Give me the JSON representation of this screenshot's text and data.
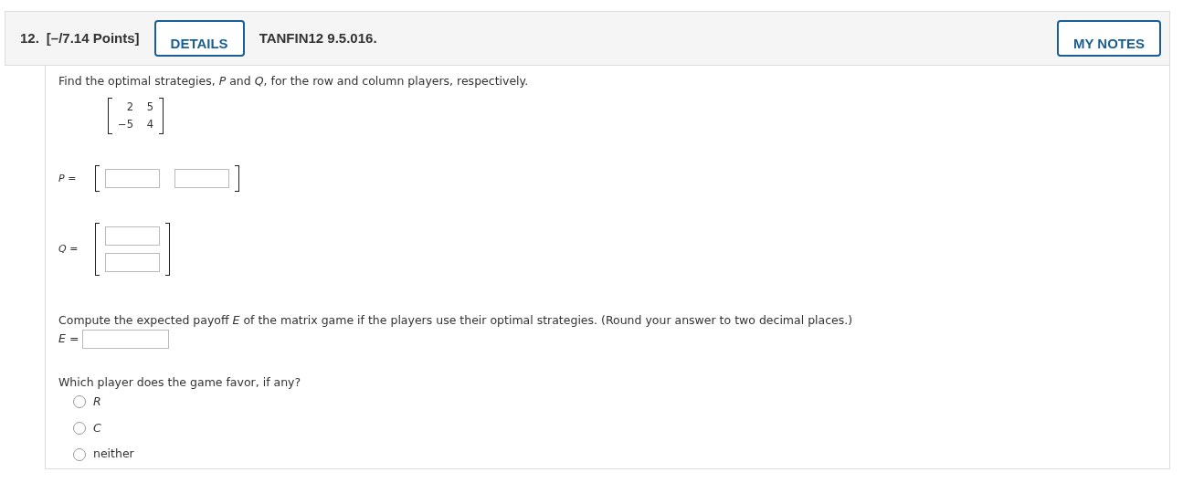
{
  "header": {
    "number": "12.",
    "points": "[–/7.14 Points]",
    "details_button": "DETAILS",
    "code": "TANFIN12 9.5.016.",
    "notes_button": "MY NOTES"
  },
  "question": {
    "prompt": "Find the optimal strategies, *P* and *Q*, for the row and column players, respectively.",
    "matrix": [
      [
        "2",
        "5"
      ],
      [
        "−5",
        "4"
      ]
    ],
    "p_label": "*P* =",
    "q_label": "*Q* =",
    "payoff_prompt": "Compute the expected payoff *E* of the matrix game if the players use their optimal strategies. (Round your answer to two decimal places.)",
    "e_label": "*E* =",
    "favor_prompt": "Which player does the game favor, if any?",
    "options": [
      {
        "label": "R",
        "italic": true,
        "selected": false
      },
      {
        "label": "C",
        "italic": true,
        "selected": false
      },
      {
        "label": "neither",
        "italic": false,
        "selected": false
      }
    ]
  }
}
